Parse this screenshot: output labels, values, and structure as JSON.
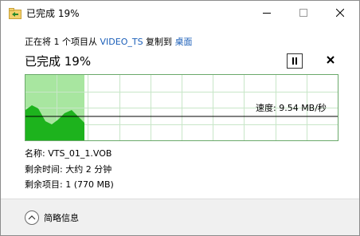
{
  "window": {
    "title": "已完成 19%",
    "controls": {
      "minimize": "minimize",
      "maximize": "maximize",
      "close": "close"
    }
  },
  "copy": {
    "prefix": "正在将 1 个项目从 ",
    "source": "VIDEO_TS",
    "middle": " 复制到 ",
    "destination": "桌面"
  },
  "status": {
    "percent_text": "已完成 19%",
    "progress": 0.19
  },
  "graph": {
    "speed_text": "速度: 9.54 MB/秒",
    "fill_color": "#a8e6a0",
    "area_color": "#1db31d",
    "grid_color": "#c8e6c8"
  },
  "details": {
    "name": "名称: VTS_01_1.VOB",
    "time_remaining": "剩余时间: 大约 2 分钟",
    "items_remaining": "剩余项目: 1 (770 MB)"
  },
  "footer": {
    "collapse_label": "简略信息"
  },
  "colors": {
    "link": "#1a5eb8"
  }
}
